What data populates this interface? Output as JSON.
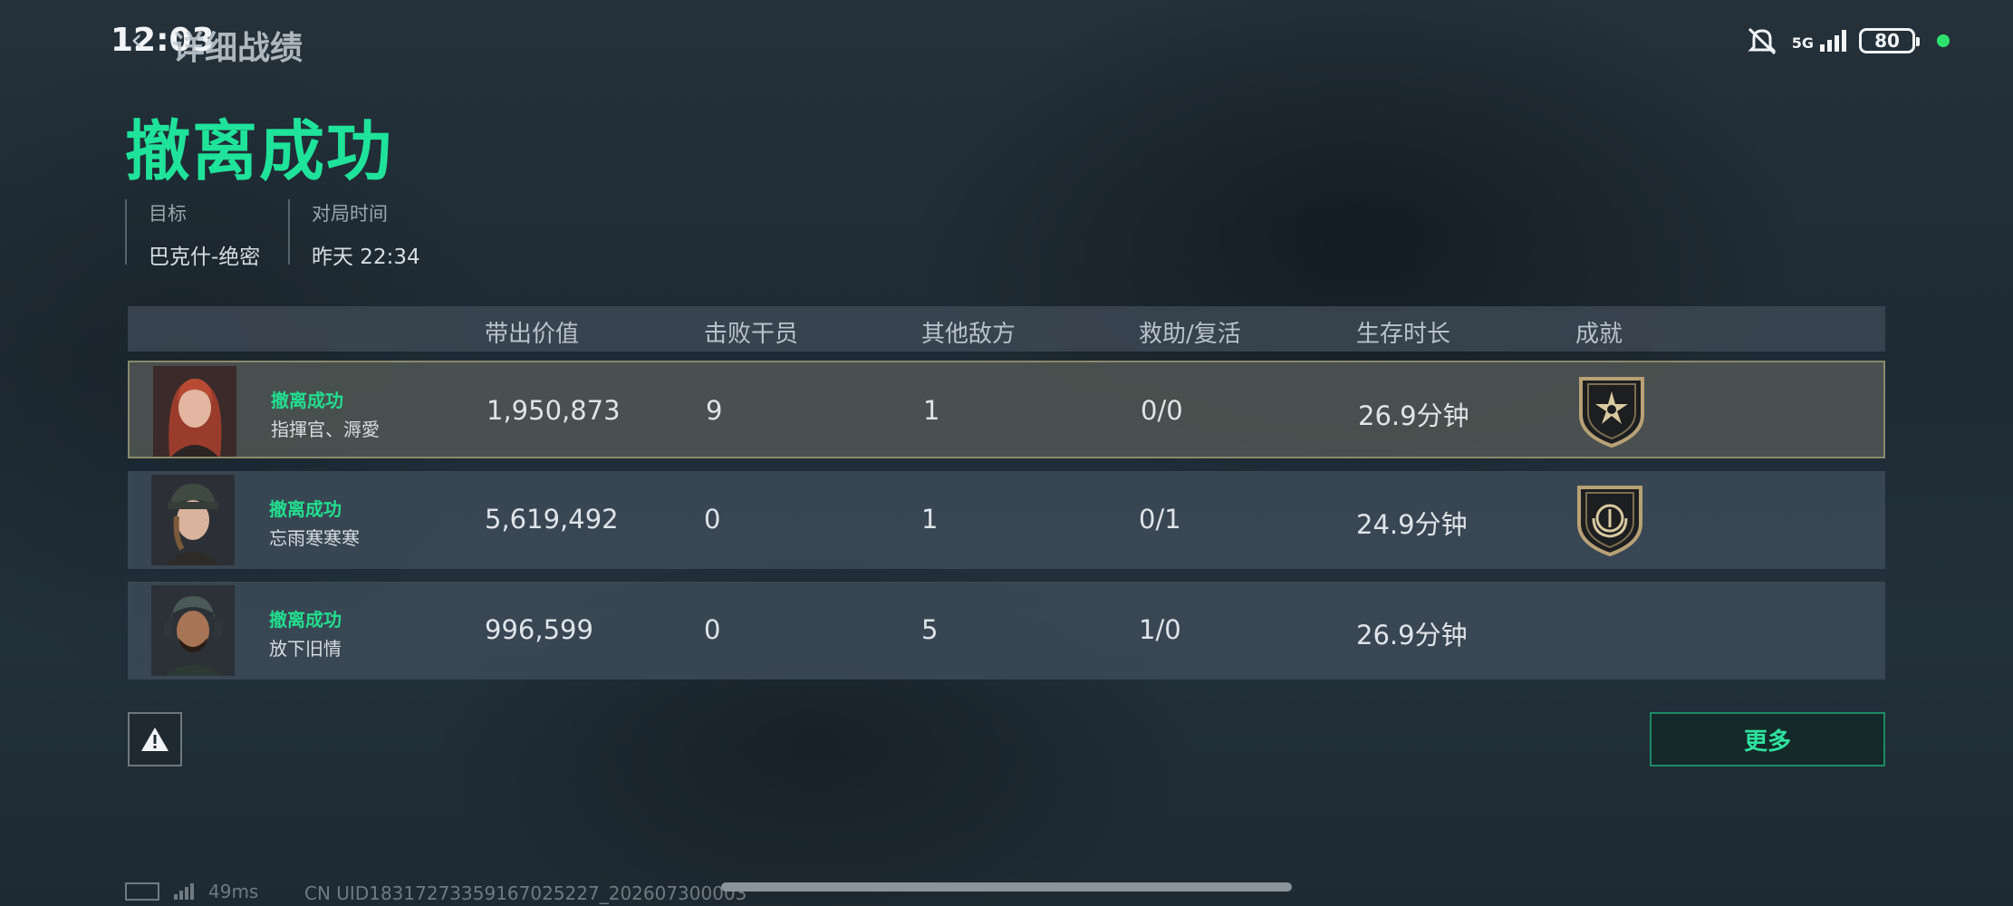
{
  "status_bar": {
    "time": "12:03",
    "network": "5G",
    "battery": "80"
  },
  "page_title": "详细战绩",
  "result": "撤离成功",
  "meta": {
    "target_label": "目标",
    "target_value": "巴克什-绝密",
    "time_label": "对局时间",
    "time_value": "昨天 22:34"
  },
  "table": {
    "headers": [
      "带出价值",
      "击败干员",
      "其他敌方",
      "救助/复活",
      "生存时长",
      "成就"
    ],
    "rows": [
      {
        "status": "撤离成功",
        "name": "指揮官、溽愛",
        "value": "1,950,873",
        "kills": "9",
        "other": "1",
        "assist": "0/0",
        "survive": "26.9分钟",
        "achievement": "star-shield-icon"
      },
      {
        "status": "撤离成功",
        "name": "忘雨寒寒寒",
        "value": "5,619,492",
        "kills": "0",
        "other": "1",
        "assist": "0/1",
        "survive": "24.9分钟",
        "achievement": "laurel-shield-icon"
      },
      {
        "status": "撤离成功",
        "name": "放下旧情",
        "value": "996,599",
        "kills": "0",
        "other": "5",
        "assist": "1/0",
        "survive": "26.9分钟",
        "achievement": ""
      }
    ]
  },
  "buttons": {
    "more": "更多",
    "report_icon": "warning-icon"
  },
  "footer": {
    "ping": "49ms",
    "uid": "CN UID1831727335916702522​7_202607300003"
  },
  "colors": {
    "accent": "#1fe39a",
    "highlight_border": "#8a8a6c"
  }
}
